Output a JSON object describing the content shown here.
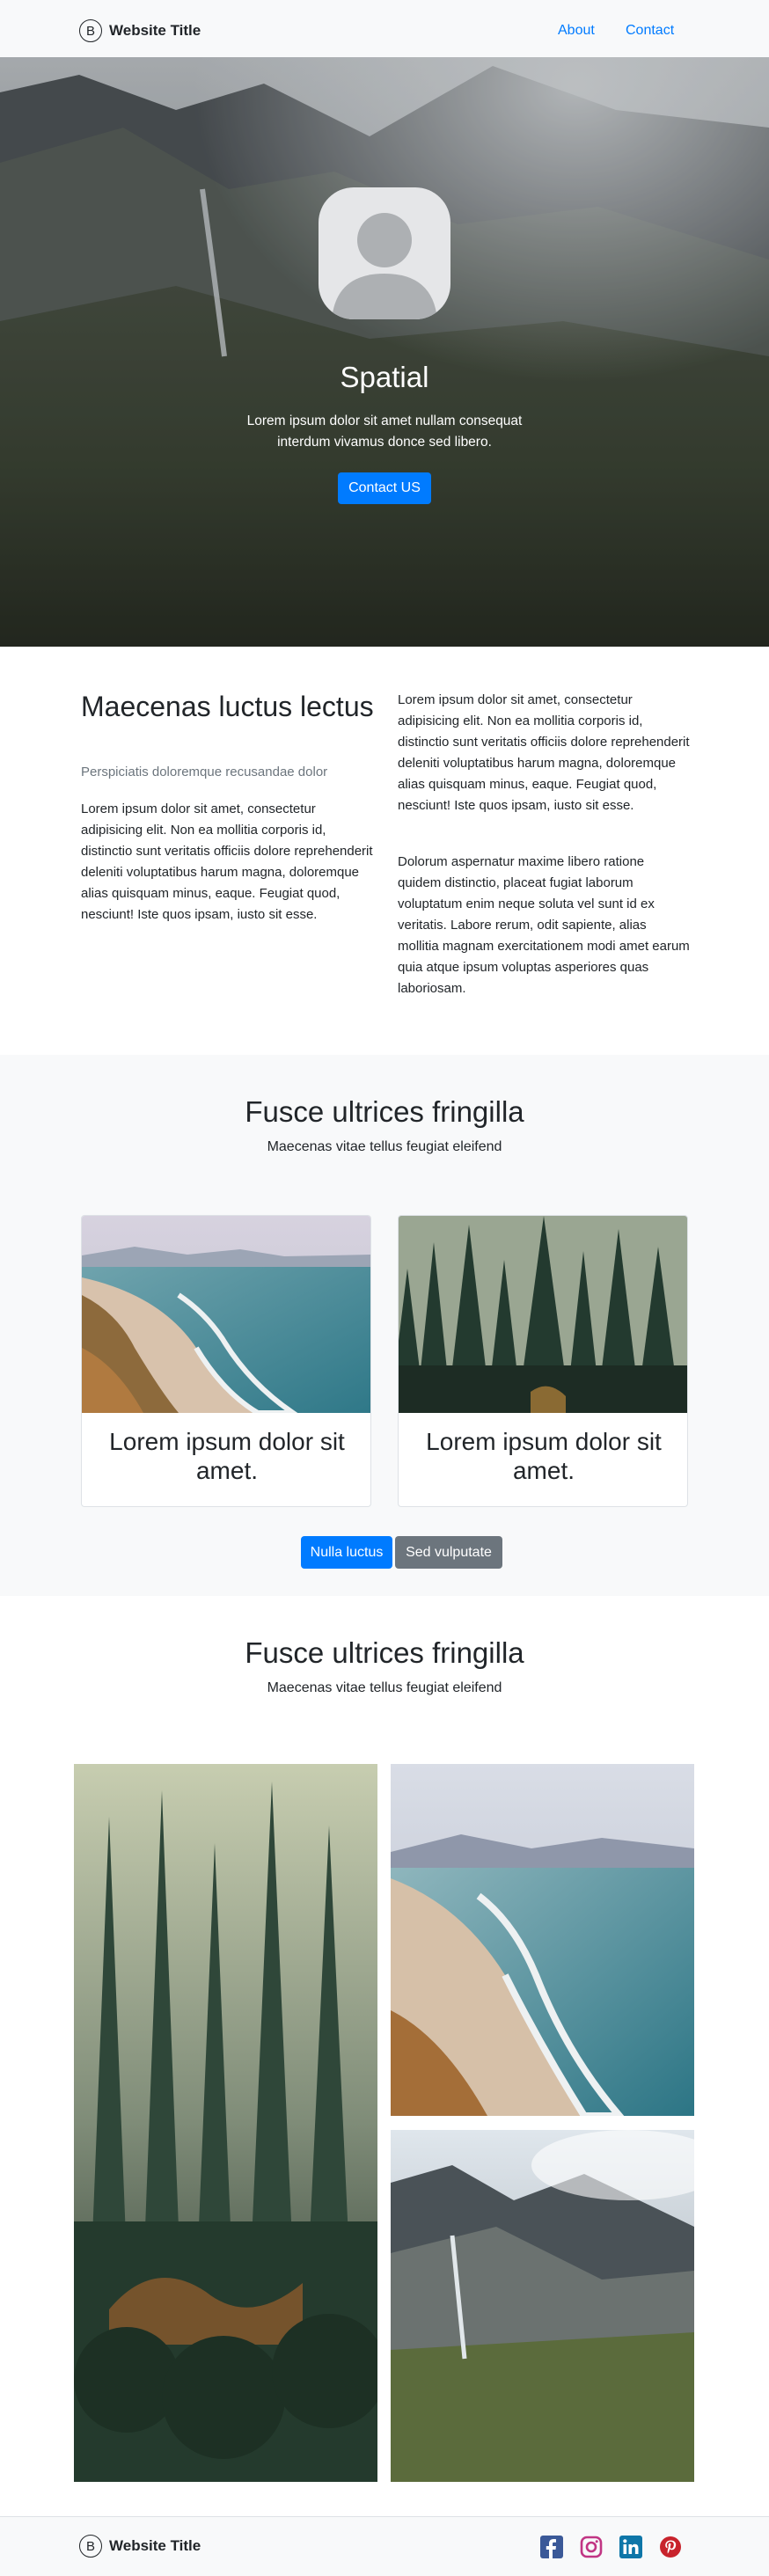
{
  "navbar": {
    "brand_letter": "B",
    "brand_title": "Website Title",
    "links": [
      "About",
      "Contact"
    ]
  },
  "hero": {
    "title": "Spatial",
    "text": "Lorem ipsum dolor sit amet nullam consequat interdum vivamus donce sed libero.",
    "button_label": "Contact US"
  },
  "about": {
    "heading": "Maecenas luctus lectus",
    "subheading": "Perspiciatis doloremque recusandae dolor",
    "left_paragraph": "Lorem ipsum dolor sit amet, consectetur adipisicing elit. Non ea mollitia corporis id, distinctio sunt veritatis officiis dolore reprehenderit deleniti voluptatibus harum magna, doloremque alias quisquam minus, eaque. Feugiat quod, nesciunt! Iste quos ipsam, iusto sit esse.",
    "right_paragraph_1": "Lorem ipsum dolor sit amet, consectetur adipisicing elit. Non ea mollitia corporis id, distinctio sunt veritatis officiis dolore reprehenderit deleniti voluptatibus harum magna, doloremque alias quisquam minus, eaque. Feugiat quod, nesciunt! Iste quos ipsam, iusto sit esse.",
    "right_paragraph_2": "Dolorum aspernatur maxime libero ratione quidem distinctio, placeat fugiat laborum voluptatum enim neque soluta vel sunt id ex veritatis. Labore rerum, odit sapiente, alias mollitia magnam exercitationem modi amet earum quia atque ipsum voluptas asperiores quas laboriosam."
  },
  "features": {
    "title": "Fusce ultrices fringilla",
    "subtitle": "Maecenas vitae tellus feugiat eleifend",
    "cards": [
      {
        "title": "Lorem ipsum dolor sit amet."
      },
      {
        "title": "Lorem ipsum dolor sit amet."
      }
    ],
    "primary_button": "Nulla luctus",
    "secondary_button": "Sed vulputate"
  },
  "gallery": {
    "title": "Fusce ultrices fringilla",
    "subtitle": "Maecenas vitae tellus feugiat eleifend"
  },
  "footer": {
    "brand_letter": "B",
    "brand_title": "Website Title",
    "social_icons": [
      "facebook-icon",
      "instagram-icon",
      "linkedin-icon",
      "pinterest-icon"
    ],
    "colors": {
      "facebook": "#3b5998",
      "instagram": "#c13584",
      "linkedin": "#0e76a8",
      "pinterest": "#c8232c"
    }
  },
  "colors": {
    "accent": "#007bff",
    "secondary": "#6c757d",
    "light_bg": "#f8f9fa"
  }
}
